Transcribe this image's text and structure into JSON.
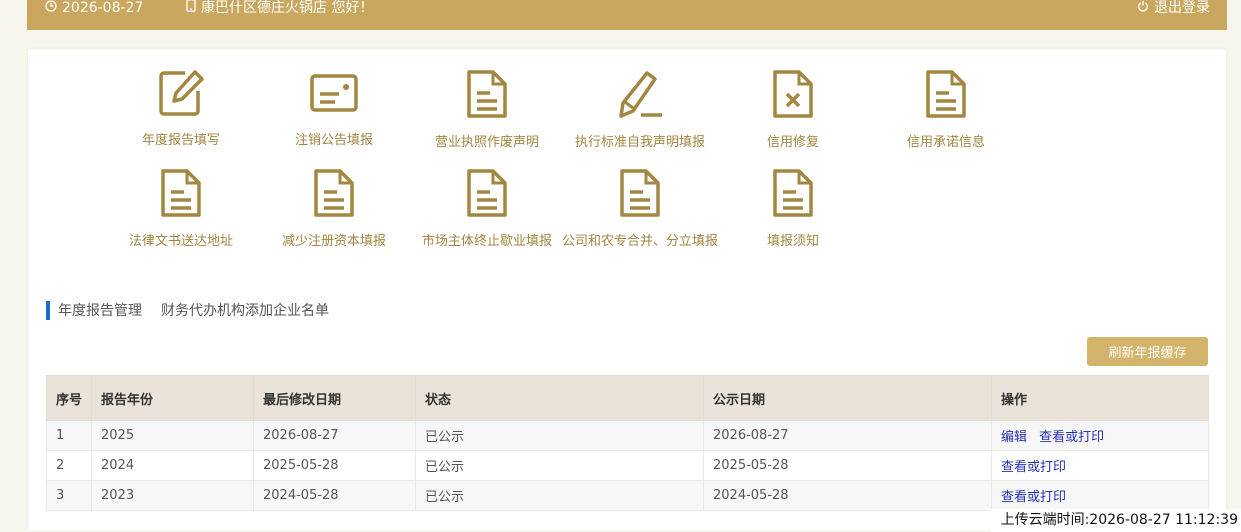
{
  "header": {
    "date": "2026-08-27",
    "greeting": "康巴什区德庄火锅店 您好！",
    "logout_label": "退出登录"
  },
  "colors": {
    "accent": "#c9a75f",
    "icon": "#a3863f",
    "button": "#d4b46a",
    "tab_marker": "#1b6bd0",
    "link": "#2432b0"
  },
  "menu": [
    {
      "label": "年度报告填写",
      "icon": "edit-icon"
    },
    {
      "label": "注销公告填报",
      "icon": "card-icon"
    },
    {
      "label": "营业执照作废声明",
      "icon": "document-icon"
    },
    {
      "label": "执行标准自我声明填报",
      "icon": "pencil-icon"
    },
    {
      "label": "信用修复",
      "icon": "document-x-icon"
    },
    {
      "label": "信用承诺信息",
      "icon": "document-icon"
    },
    {
      "label": "法律文书送达地址",
      "icon": "document-icon"
    },
    {
      "label": "减少注册资本填报",
      "icon": "document-icon"
    },
    {
      "label": "市场主体终止歇业填报",
      "icon": "document-icon"
    },
    {
      "label": "公司和农专合并、分立填报",
      "icon": "document-icon"
    },
    {
      "label": "填报须知",
      "icon": "document-icon"
    }
  ],
  "tabs": [
    "年度报告管理",
    "财务代办机构添加企业名单"
  ],
  "refresh_button": "刷新年报缓存",
  "table": {
    "columns": [
      "序号",
      "报告年份",
      "最后修改日期",
      "状态",
      "公示日期",
      "操作"
    ],
    "rows": [
      {
        "no": "1",
        "year": "2025",
        "modified": "2026-08-27",
        "status": "已公示",
        "published": "2026-08-27",
        "actions": [
          "编辑",
          "查看或打印"
        ]
      },
      {
        "no": "2",
        "year": "2024",
        "modified": "2025-05-28",
        "status": "已公示",
        "published": "2025-05-28",
        "actions": [
          "查看或打印"
        ]
      },
      {
        "no": "3",
        "year": "2023",
        "modified": "2024-05-28",
        "status": "已公示",
        "published": "2024-05-28",
        "actions": [
          "查看或打印"
        ]
      }
    ]
  },
  "upload_time": "上传云端时间:2026-08-27 11:12:39"
}
